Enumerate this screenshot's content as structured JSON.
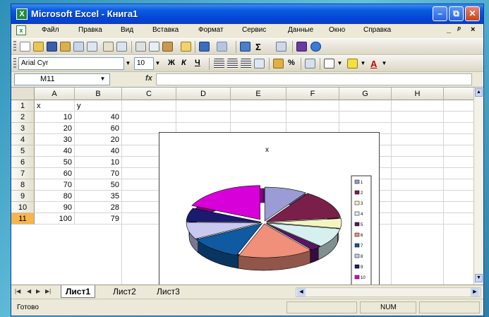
{
  "window": {
    "title": "Microsoft Excel - Книга1",
    "app_icon": "X"
  },
  "menu": [
    "Файл",
    "Правка",
    "Вид",
    "Вставка",
    "Формат",
    "Сервис",
    "Данные",
    "Окно",
    "Справка"
  ],
  "menu_controls": {
    "minimize": "–",
    "restore": "⧉",
    "close": "✕",
    "doc_minimize": "_",
    "doc_close": "×"
  },
  "toolbar": {
    "font_name": "Arial Cyr",
    "font_size": "10",
    "bold": "Ж",
    "italic": "К",
    "underline": "Ч",
    "percent": "%",
    "sigma": "Σ"
  },
  "formula_bar": {
    "cell_ref": "M11",
    "fx": "fx",
    "value": ""
  },
  "columns": [
    "A",
    "B",
    "C",
    "D",
    "E",
    "F",
    "G",
    "H"
  ],
  "rows": [
    "1",
    "2",
    "3",
    "4",
    "5",
    "6",
    "7",
    "8",
    "9",
    "10",
    "11"
  ],
  "selected_row": "11",
  "table": {
    "header": [
      "x",
      "y"
    ],
    "data": [
      [
        "10",
        "40"
      ],
      [
        "20",
        "60"
      ],
      [
        "30",
        "20"
      ],
      [
        "40",
        "40"
      ],
      [
        "50",
        "10"
      ],
      [
        "60",
        "70"
      ],
      [
        "70",
        "50"
      ],
      [
        "80",
        "35"
      ],
      [
        "90",
        "28"
      ],
      [
        "100",
        "79"
      ]
    ]
  },
  "chart_data": {
    "type": "pie",
    "title": "x",
    "legend_placement": "right",
    "categories": [
      "1",
      "2",
      "3",
      "4",
      "5",
      "6",
      "7",
      "8",
      "9",
      "10"
    ],
    "values": [
      40,
      60,
      20,
      40,
      10,
      70,
      50,
      35,
      28,
      79
    ],
    "colors": [
      "#9b9bd6",
      "#7a1f4a",
      "#f4f4c0",
      "#d6f0f0",
      "#5a1466",
      "#f0907a",
      "#0f5aa0",
      "#c8c8f0",
      "#1a1a6e",
      "#d800d8"
    ]
  },
  "sheets": [
    "Лист1",
    "Лист2",
    "Лист3"
  ],
  "active_sheet": "Лист1",
  "status": {
    "text": "Готово",
    "num": "NUM"
  }
}
